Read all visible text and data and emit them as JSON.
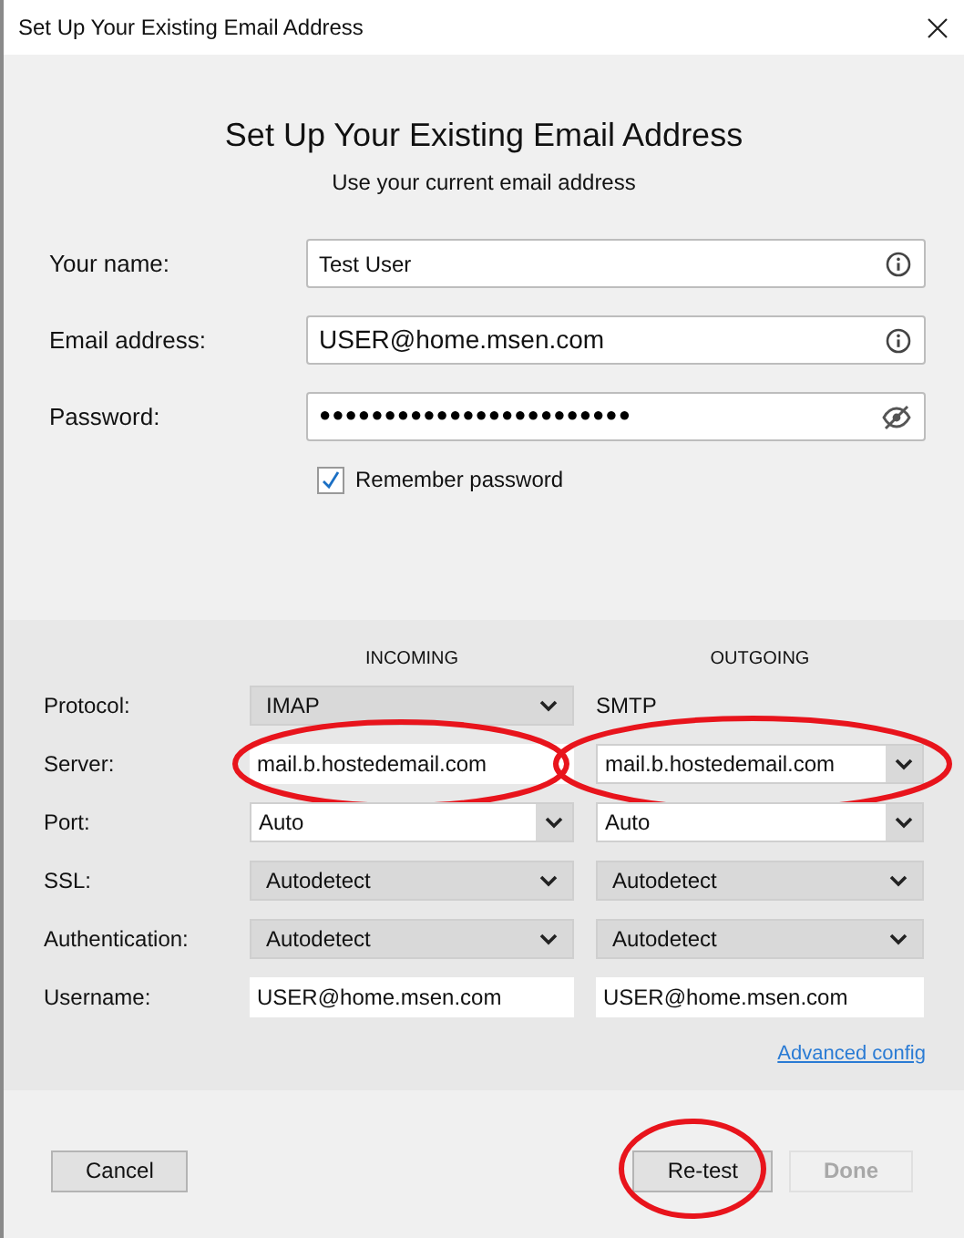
{
  "window": {
    "title": "Set Up Your Existing Email Address"
  },
  "heading": "Set Up Your Existing Email Address",
  "subheading": "Use your current email address",
  "fields": [
    {
      "label": "Your name:",
      "value": "Test User",
      "kind": "info"
    },
    {
      "label": "Email address:",
      "value": "USER@home.msen.com",
      "kind": "info"
    },
    {
      "label": "Password:",
      "value": "●●●●●●●●●●●●●●●●●●●●●●●●",
      "kind": "password"
    }
  ],
  "remember_password": {
    "label": "Remember password",
    "checked": true
  },
  "server": {
    "incoming_header": "INCOMING",
    "outgoing_header": "OUTGOING",
    "rows": [
      {
        "label": "Protocol:",
        "incoming": {
          "kind": "select",
          "value": "IMAP",
          "circled": false
        },
        "outgoing": {
          "kind": "text",
          "value": "SMTP"
        }
      },
      {
        "label": "Server:",
        "incoming": {
          "kind": "input",
          "value": "mail.b.hostedemail.com",
          "circled": true
        },
        "outgoing": {
          "kind": "combo",
          "value": "mail.b.hostedemail.com",
          "circled": true
        }
      },
      {
        "label": "Port:",
        "incoming": {
          "kind": "combo",
          "value": "Auto",
          "circled": false
        },
        "outgoing": {
          "kind": "combo",
          "value": "Auto",
          "circled": false
        }
      },
      {
        "label": "SSL:",
        "incoming": {
          "kind": "select",
          "value": "Autodetect",
          "circled": false
        },
        "outgoing": {
          "kind": "select",
          "value": "Autodetect",
          "circled": false
        }
      },
      {
        "label": "Authentication:",
        "incoming": {
          "kind": "select",
          "value": "Autodetect",
          "circled": false
        },
        "outgoing": {
          "kind": "select",
          "value": "Autodetect",
          "circled": false
        }
      },
      {
        "label": "Username:",
        "incoming": {
          "kind": "input",
          "value": "USER@home.msen.com",
          "circled": false
        },
        "outgoing": {
          "kind": "input",
          "value": "USER@home.msen.com",
          "circled": false
        }
      }
    ],
    "advanced_link": "Advanced config"
  },
  "buttons": [
    {
      "label": "Cancel",
      "disabled": false,
      "circled": false
    },
    {
      "label": "Re-test",
      "disabled": false,
      "circled": true
    },
    {
      "label": "Done",
      "disabled": true,
      "circled": false
    }
  ]
}
